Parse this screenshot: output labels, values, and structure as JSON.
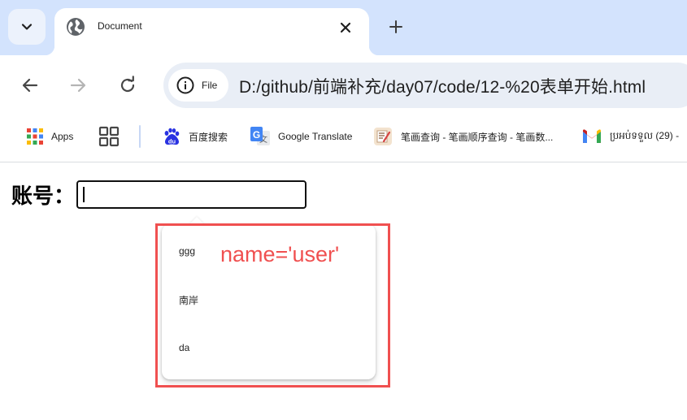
{
  "tab": {
    "title": "Document",
    "favicon": "globe-icon"
  },
  "toolbar": {
    "chip_label": "File",
    "url": "D:/github/前端补充/day07/code/12-%20表单开始.html"
  },
  "bookmarks": [
    {
      "label": "Apps",
      "icon": "apps-grid-icon"
    },
    {
      "label": "",
      "icon": "tab-groups-icon"
    },
    {
      "label": "百度搜索",
      "icon": "baidu-icon"
    },
    {
      "label": "Google Translate",
      "icon": "google-translate-icon"
    },
    {
      "label": "笔画查询 - 笔画顺序查询 - 笔画数...",
      "icon": "stroke-dict-icon"
    },
    {
      "label": "ប្រអប់ទទួល (29) -",
      "icon": "gmail-icon"
    }
  ],
  "form": {
    "label": "账号：",
    "input_value": ""
  },
  "autocomplete": {
    "options": [
      "ggg",
      "南岸",
      "da"
    ]
  },
  "annotation": {
    "text": "name='user'",
    "color": "#f05050"
  },
  "colors": {
    "tabstrip": "#d3e3fd",
    "omnibox": "#e9eef6",
    "annotation": "#f05050"
  }
}
